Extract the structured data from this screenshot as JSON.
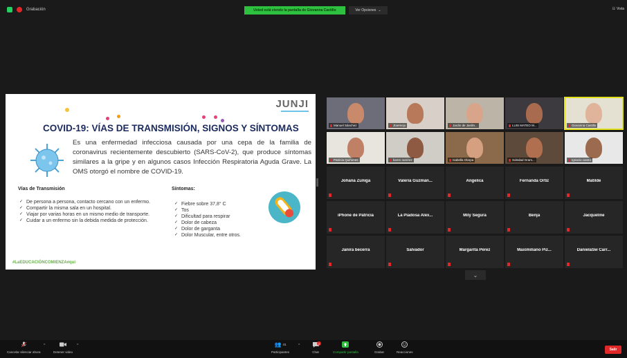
{
  "topbar": {
    "recording_label": "Grabación",
    "share_banner": "Usted está viendo la pantalla de Giovanna Castillo",
    "view_options": "Ver Opciones",
    "view_options_caret": "⌄",
    "vista_label": "Vista"
  },
  "slide": {
    "logo": "JUNJI",
    "title": "COVID-19: VÍAS DE TRANSMISIÓN, SIGNOS Y SÍNTOMAS",
    "intro": "Es una enfermedad infecciosa causada por una cepa de la familia de coronavirus recientemente descubierto (SARS-CoV-2), que produce síntomas similares a la gripe y en algunos casos Infección Respiratoria Aguda Grave. La OMS otorgó el nombre de COVID-19.",
    "transmission_heading": "Vías de Transmisión",
    "transmission_items": [
      "De persona a persona, contacto cercano con un enfermo.",
      "Compartir la misma sala en un hospital.",
      "Viajar por varias horas en un mismo medio de transporte.",
      "Cuidar a un enfermo sin la debida medida de protección."
    ],
    "symptoms_heading": "Síntomas:",
    "symptoms_items": [
      "Fiebre sobre 37,8° C",
      "Tos",
      "Dificultad para respirar",
      "Dolor de cabeza",
      "Dolor de garganta",
      "Dolor Muscular, entre otros."
    ],
    "hashtag": "#LaEDUCACIÓNCOMIENZA#qui",
    "colors": {
      "title": "#1b2a5e",
      "accent_pink": "#e83f7a",
      "accent_orange": "#f39c12",
      "accent_blue": "#4ab6c8"
    }
  },
  "participants": {
    "video_tiles": [
      {
        "name": "Manuel Sánchez"
      },
      {
        "name": "Jtoemejo"
      },
      {
        "name": "Jardin de Jardin..."
      },
      {
        "name": "LUIS MATEO M..."
      },
      {
        "name": "Giovanna Castillo"
      },
      {
        "name": "Patricia Quiñones"
      },
      {
        "name": "karen ramírez"
      },
      {
        "name": "Isabella Olarpa"
      },
      {
        "name": "Soledad Gram..."
      },
      {
        "name": "Ignacio castro"
      }
    ],
    "name_tiles": [
      "Johana Zuñiga",
      "Valeria Guzmán...",
      "Angelica",
      "Fernanda Ortiz",
      "Matilde",
      "iPhone de Patricia",
      "La Piadosa Alex...",
      "Mily Segura",
      "Benja",
      "Jacqueline",
      "Janira becerra",
      "Salvador",
      "Margarita Pérez",
      "Maximiliano Piz...",
      "DanielaSw Carr..."
    ],
    "next_page_icon": "⌄"
  },
  "toolbar": {
    "mute_label": "Cancelar silenciar ahora",
    "video_label": "Detener video",
    "participants_label": "Participantes",
    "participants_count": "41",
    "chat_label": "Chat",
    "chat_badge": "2",
    "share_label": "Compartir pantalla",
    "record_label": "Grabar",
    "reactions_label": "Reacciones",
    "leave_label": "Salir",
    "caret": "^"
  }
}
